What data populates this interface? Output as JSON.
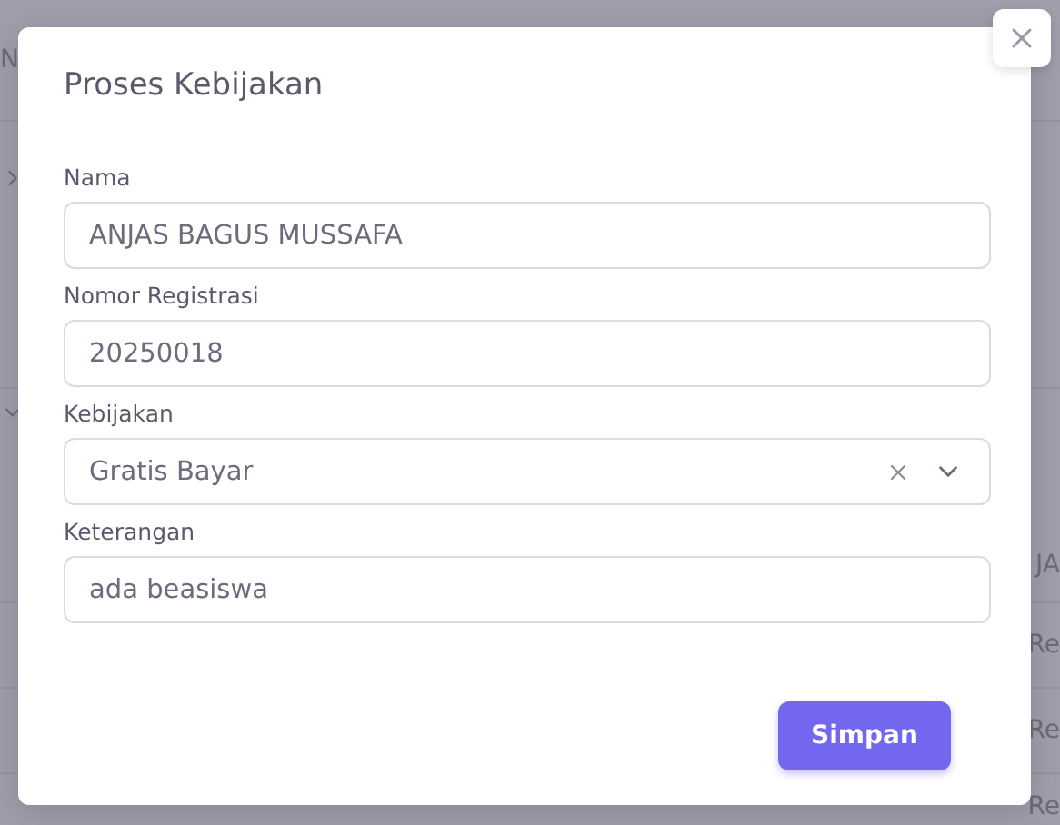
{
  "background": {
    "header_fragment": "N",
    "column_header": "JA",
    "rows": [
      {
        "status": "Re"
      },
      {
        "status": "Re"
      },
      {
        "status": "Re"
      }
    ]
  },
  "modal": {
    "title": "Proses Kebijakan",
    "fields": [
      {
        "kind": "text",
        "label": "Nama",
        "value": "ANJAS BAGUS MUSSAFA"
      },
      {
        "kind": "text",
        "label": "Nomor Registrasi",
        "value": "20250018"
      },
      {
        "kind": "select",
        "label": "Kebijakan",
        "value": "Gratis Bayar"
      },
      {
        "kind": "text",
        "label": "Keterangan",
        "value": "ada beasiswa"
      }
    ],
    "submit": "Simpan"
  }
}
